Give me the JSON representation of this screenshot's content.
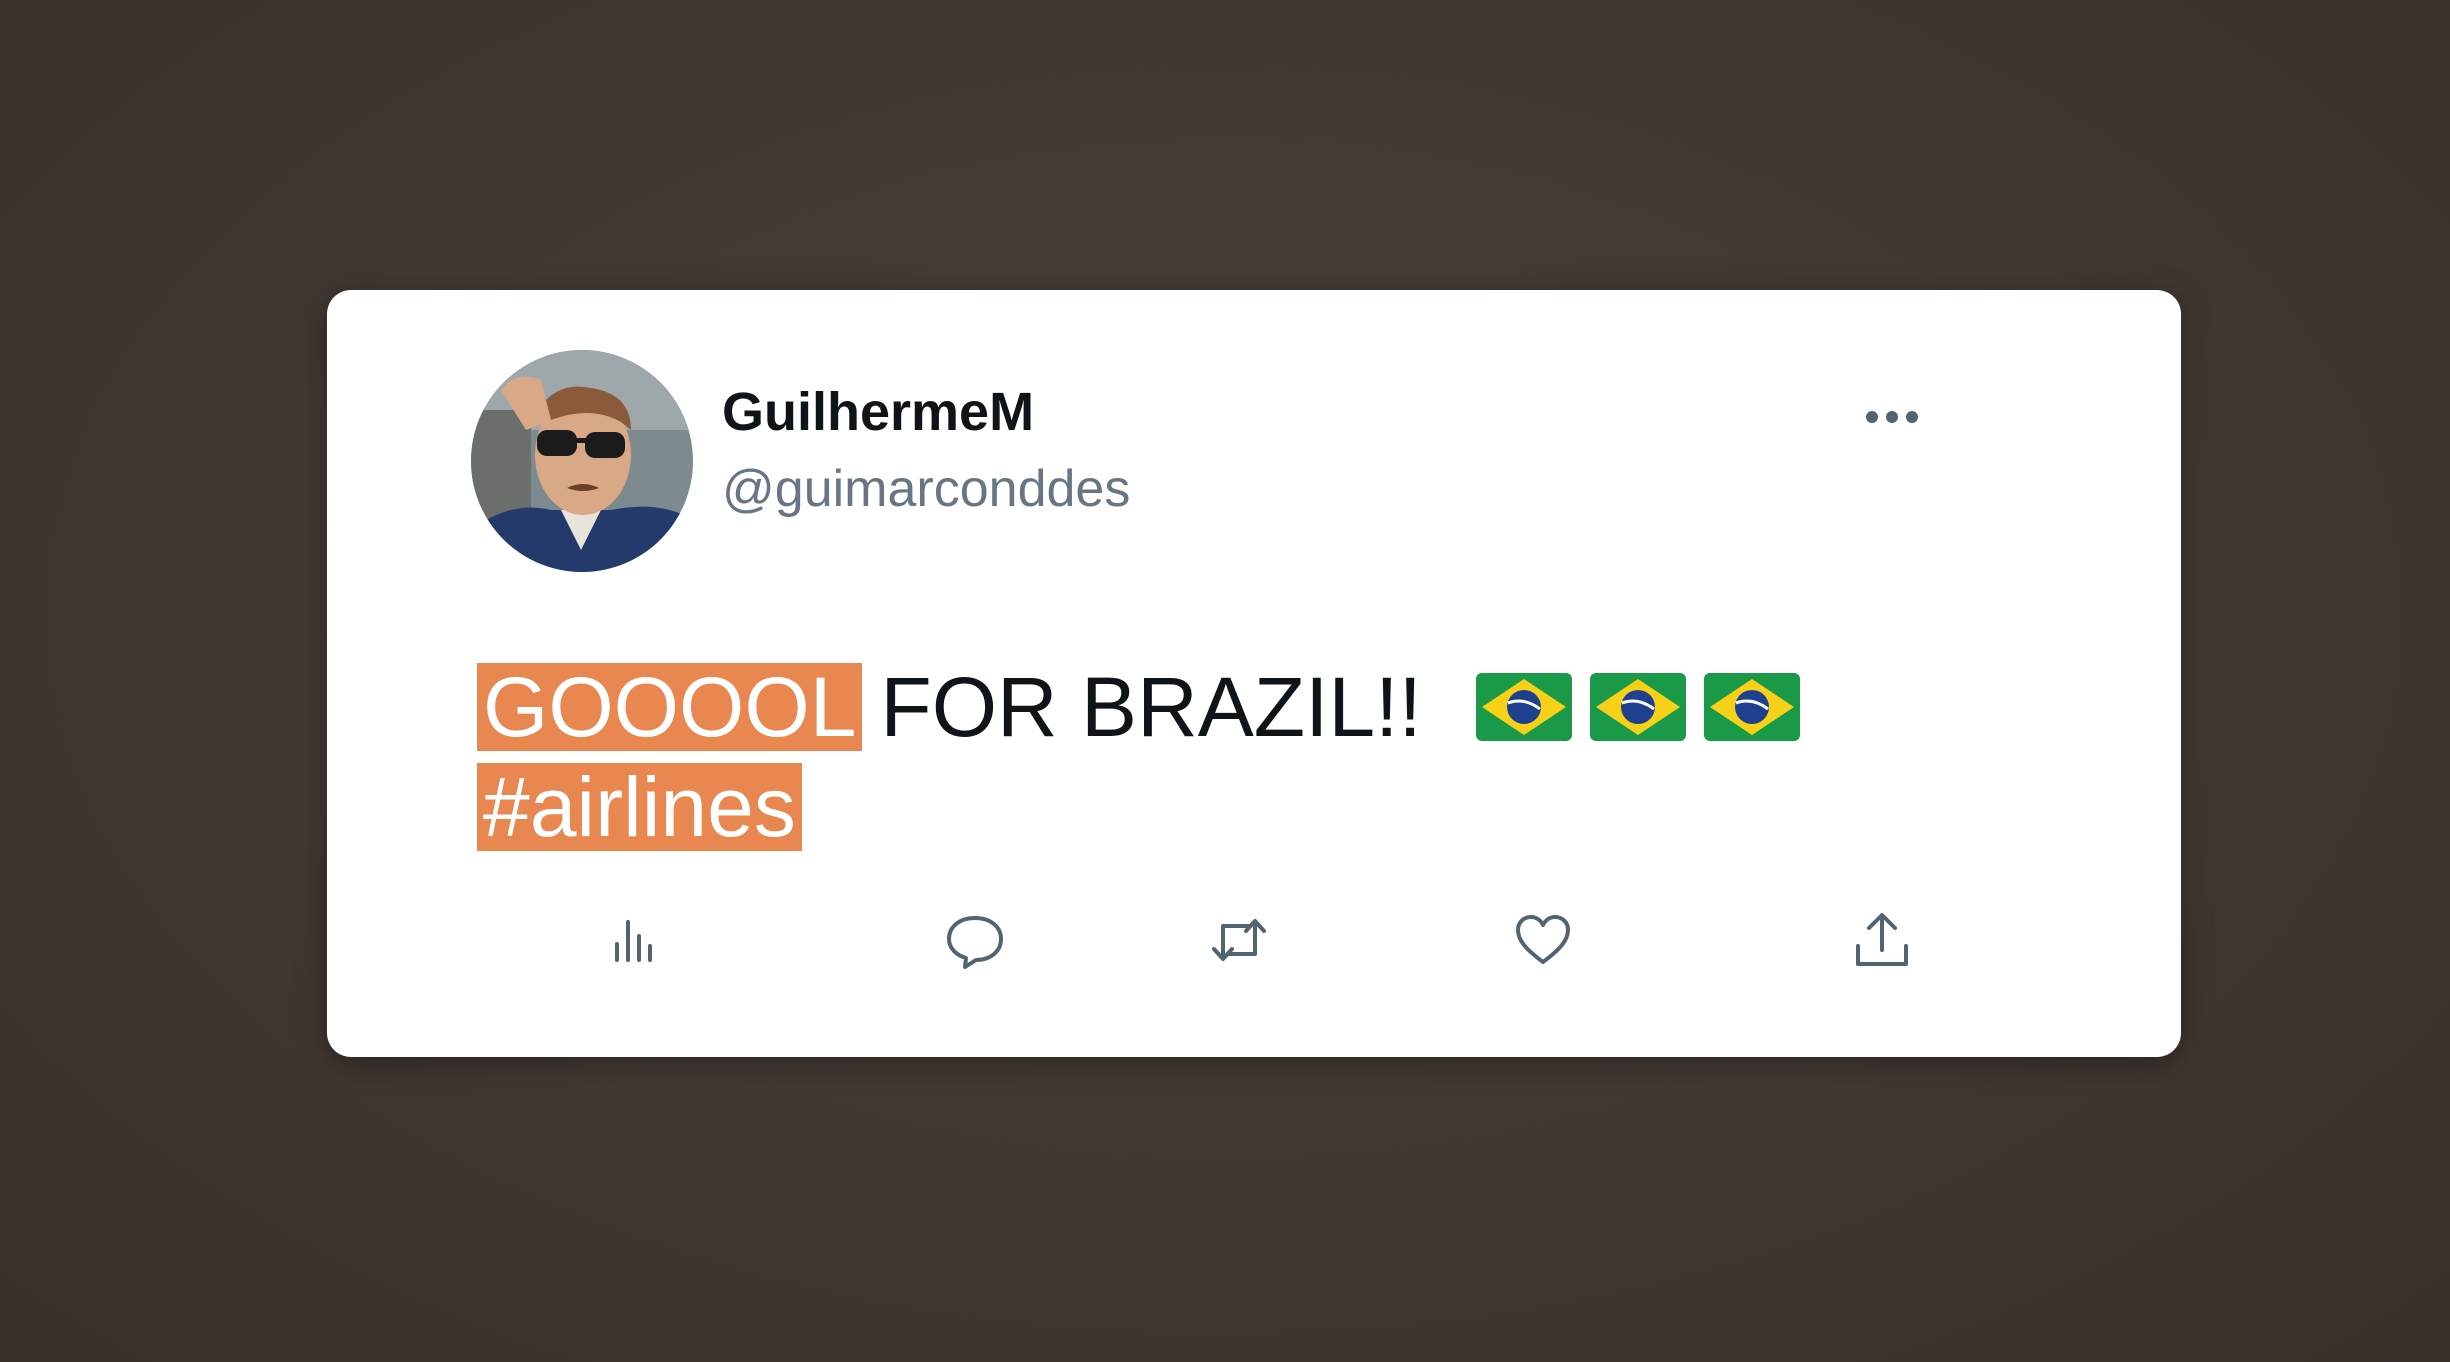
{
  "tweet": {
    "display_name": "GuilhermeM",
    "handle": "@guimarconddes",
    "text_highlight": "GOOOOL",
    "text_main": "FOR BRAZIL!!",
    "flag_emoji": "brazil-flag",
    "flag_count": 3,
    "hashtag": "#airlines"
  },
  "actions": [
    {
      "name": "views",
      "icon": "bar-chart-icon"
    },
    {
      "name": "reply",
      "icon": "speech-bubble-icon"
    },
    {
      "name": "retweet",
      "icon": "retweet-icon"
    },
    {
      "name": "like",
      "icon": "heart-icon"
    },
    {
      "name": "share",
      "icon": "share-upload-icon"
    }
  ],
  "colors": {
    "highlight": "#e8874f",
    "background": "#433934",
    "card": "#ffffff",
    "handle": "#687684"
  }
}
